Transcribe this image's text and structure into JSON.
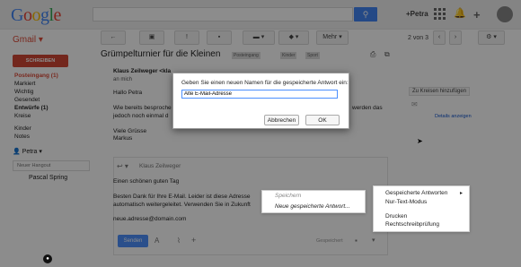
{
  "header": {
    "logo": [
      "G",
      "o",
      "o",
      "g",
      "l",
      "e"
    ],
    "plus_user": "+Petra",
    "search_placeholder": ""
  },
  "app": {
    "name": "Gmail",
    "name_arrow": "▾"
  },
  "toolbar": {
    "more_label": "Mehr",
    "more_arrow": "▾",
    "count": "2 von 3"
  },
  "sidebar": {
    "compose_label": "SCHREIBEN",
    "items": [
      "Posteingang (1)",
      "Markiert",
      "Wichtig",
      "Gesendet",
      "Entwürfe (1)",
      "Kreise",
      "Kinder",
      "Notes"
    ],
    "hangouts_user": "Petra",
    "new_hangout_placeholder": "Neuer Hangout",
    "contact": "Pascal Spring"
  },
  "conversation": {
    "subject": "Grümpelturnier für die Kleinen",
    "labels": [
      "Posteingang",
      "Kinder",
      "Sport"
    ],
    "sender": "Klaus Zeilweger <kla",
    "to": "an mich",
    "lines": [
      "Hallo Petra",
      "Wie bereits besproche",
      "jedoch noch einmal d",
      "Viele Grüsse",
      "Markus"
    ],
    "lines_right": "werden das",
    "lines_right2": "jedoch"
  },
  "right_pane": {
    "add_to_circles": "Zu Kreisen hinzufügen",
    "details_link": "Details anzeigen"
  },
  "reply": {
    "from": "Klaus Zeilweger",
    "greeting": "Einen schönen guten Tag",
    "body1": "Besten Dank für Ihre E-Mail. Leider ist diese Adresse",
    "body2": "automatisch weitergeleitet. Verwenden Sie in Zukunft",
    "address": "neue.adresse@domain.com",
    "send_label": "Senden",
    "draft_label": "Gespeichert"
  },
  "dialog": {
    "question": "Geben Sie einen neuen Namen für die gespeicherte Antwort ein:",
    "input_value": "Alte E-Mail-Adresse",
    "cancel_label": "Abbrechen",
    "ok_label": "OK"
  },
  "submenu": {
    "items": [
      "Speichern",
      "Neue gespeicherte Antwort..."
    ]
  },
  "context_menu": {
    "items": [
      "Gespeicherte Antworten",
      "Nur-Text-Modus",
      "Drucken",
      "Rechtschreibprüfung"
    ],
    "arrow": "▸"
  },
  "colors": {
    "brand_red": "#dd4b39",
    "blue": "#4285f4",
    "compose": "#d14836"
  }
}
